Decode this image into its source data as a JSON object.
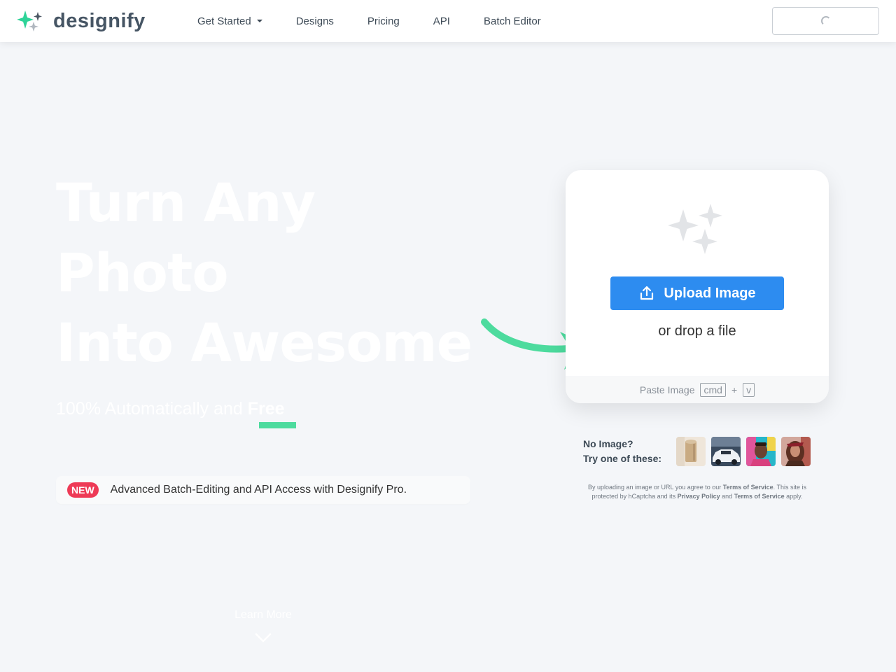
{
  "header": {
    "brand": "designify",
    "nav": [
      {
        "label": "Get Started"
      },
      {
        "label": "Designs"
      },
      {
        "label": "Pricing"
      },
      {
        "label": "API"
      },
      {
        "label": "Batch Editor"
      }
    ]
  },
  "hero": {
    "title_lines": [
      "Turn Any",
      "Photo",
      "Into Awesome"
    ],
    "subtitle_prefix": "100% Automatically and ",
    "subtitle_free": "Free",
    "new_badge": "NEW",
    "new_text": "Advanced Batch-Editing and API Access with Designify Pro.",
    "learn_more": "Learn More"
  },
  "upload": {
    "button_label": "Upload Image",
    "drop_text": "or drop a file",
    "paste_label": "Paste Image",
    "key1": "cmd",
    "plus": "+",
    "key2": "v"
  },
  "samples": {
    "line1": "No Image?",
    "line2": "Try one of these:",
    "thumbnails": [
      {
        "name": "product-roll"
      },
      {
        "name": "car"
      },
      {
        "name": "man-portrait"
      },
      {
        "name": "woman-portrait"
      }
    ]
  },
  "legal": {
    "t1": "By uploading an image or URL you agree to our ",
    "terms1": "Terms of Service",
    "t2": ". This site is protected by hCaptcha and its ",
    "privacy": "Privacy Policy",
    "t3": " and ",
    "terms2": "Terms of Service",
    "t4": " apply."
  },
  "colors": {
    "brand_green": "#4ddb9e",
    "upload_blue": "#2d8cf0",
    "new_red": "#ee3a56"
  },
  "icons": [
    "sparkles-logo-icon",
    "caret-down-icon",
    "loading-spinner-icon",
    "sparkles-icon",
    "upload-icon",
    "curved-arrow-icon",
    "chevron-down-icon"
  ]
}
